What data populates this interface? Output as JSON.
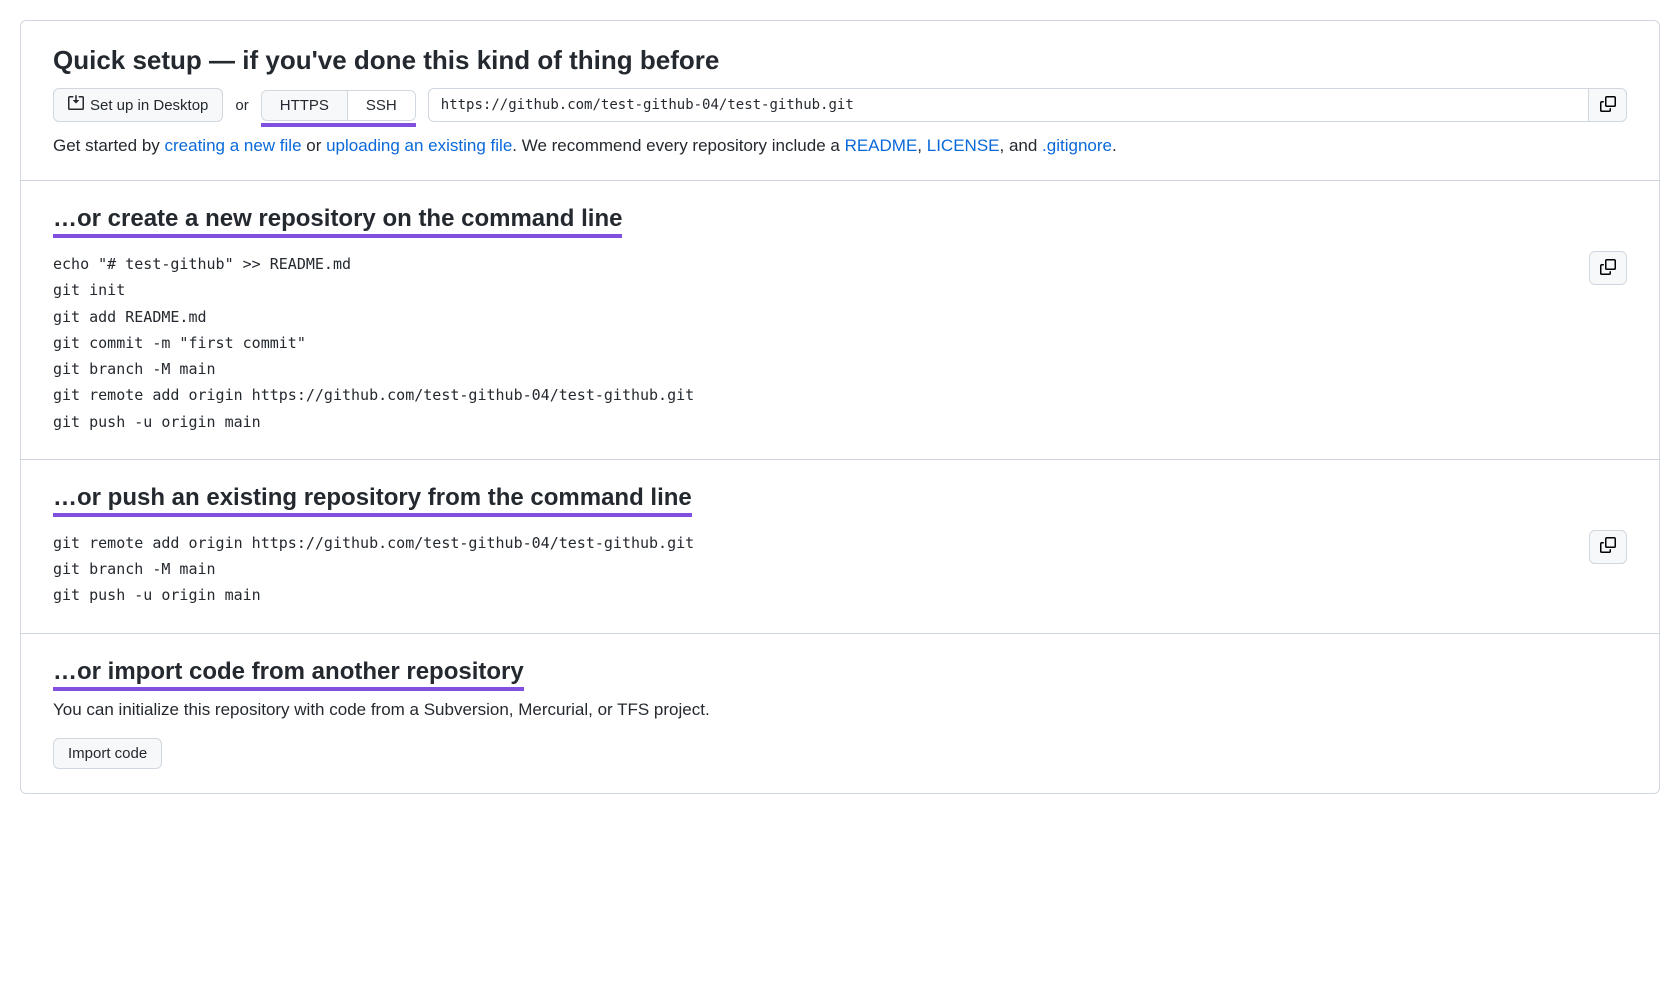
{
  "quick": {
    "title": "Quick setup — if you've done this kind of thing before",
    "desktop_btn": "Set up in Desktop",
    "or": "or",
    "https_tab": "HTTPS",
    "ssh_tab": "SSH",
    "clone_url": "https://github.com/test-github-04/test-github.git",
    "help_prefix": "Get started by ",
    "link_create": "creating a new file",
    "help_or": " or ",
    "link_upload": "uploading an existing file",
    "help_mid": ". We recommend every repository include a ",
    "link_readme": "README",
    "comma1": ", ",
    "link_license": "LICENSE",
    "comma2": ", and ",
    "link_gitignore": ".gitignore",
    "period": "."
  },
  "create": {
    "heading": "…or create a new repository on the command line",
    "code": "echo \"# test-github\" >> README.md\ngit init\ngit add README.md\ngit commit -m \"first commit\"\ngit branch -M main\ngit remote add origin https://github.com/test-github-04/test-github.git\ngit push -u origin main"
  },
  "push": {
    "heading": "…or push an existing repository from the command line",
    "code": "git remote add origin https://github.com/test-github-04/test-github.git\ngit branch -M main\ngit push -u origin main"
  },
  "import": {
    "heading": "…or import code from another repository",
    "text": "You can initialize this repository with code from a Subversion, Mercurial, or TFS project.",
    "btn": "Import code"
  }
}
